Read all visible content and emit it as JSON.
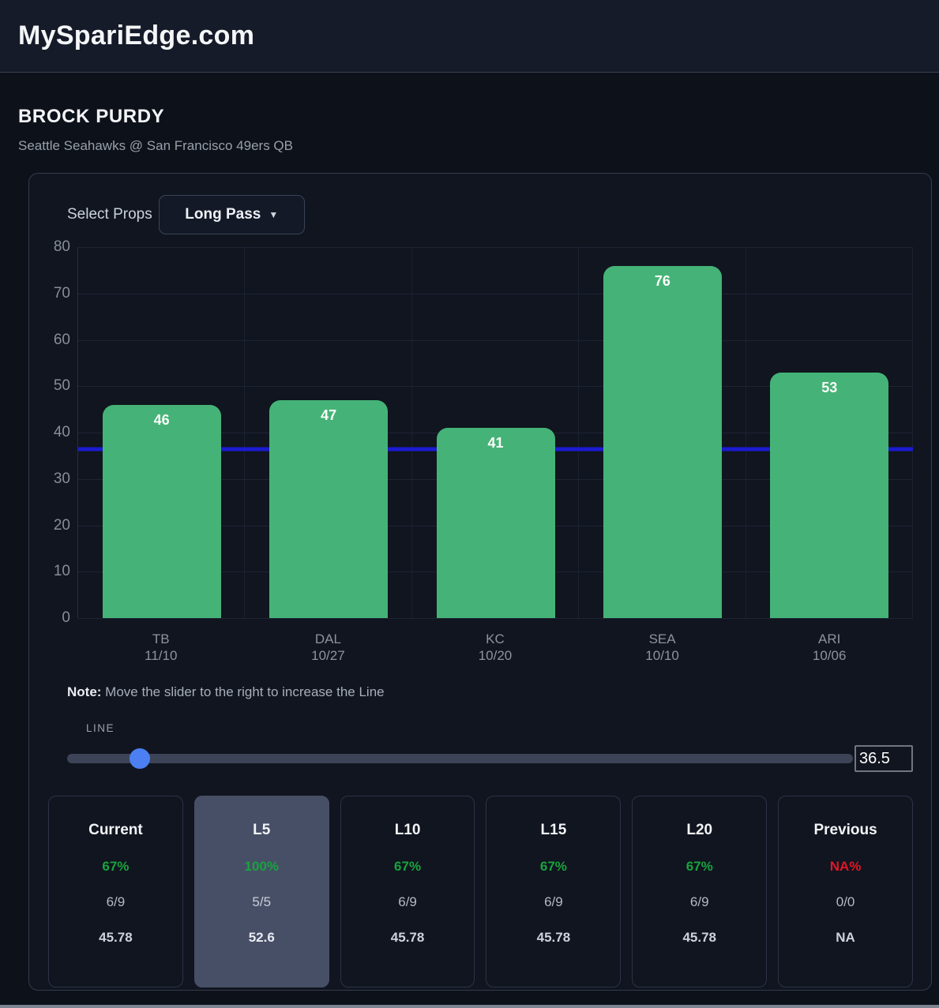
{
  "site": {
    "title": "MySpariEdge.com"
  },
  "player": {
    "name": "BROCK PURDY",
    "matchup": "Seattle Seahawks @ San Francisco 49ers QB"
  },
  "props": {
    "label": "Select Props",
    "selected": "Long Pass"
  },
  "chart_data": {
    "type": "bar",
    "title": "",
    "xlabel": "",
    "ylabel": "",
    "categories": [
      {
        "team": "TB",
        "date": "11/10"
      },
      {
        "team": "DAL",
        "date": "10/27"
      },
      {
        "team": "KC",
        "date": "10/20"
      },
      {
        "team": "SEA",
        "date": "10/10"
      },
      {
        "team": "ARI",
        "date": "10/06"
      }
    ],
    "values": [
      46,
      47,
      41,
      76,
      53
    ],
    "ylim": [
      0,
      80
    ],
    "yticks": [
      0,
      10,
      20,
      30,
      40,
      50,
      60,
      70,
      80
    ],
    "line_value": 36.5,
    "grid": true,
    "legend": false,
    "bar_color": "#45b377",
    "line_color": "#1b1bd1"
  },
  "note": {
    "bold": "Note:",
    "text": " Move the slider to the right to increase the Line"
  },
  "slider": {
    "label": "LINE",
    "value": "36.5",
    "thumb_percent": 9.2,
    "thumb_color": "#4c7ff2"
  },
  "cards": [
    {
      "label": "Current",
      "pct": "67%",
      "pct_color": "green",
      "ratio": "6/9",
      "value": "45.78",
      "highlight": false
    },
    {
      "label": "L5",
      "pct": "100%",
      "pct_color": "green",
      "ratio": "5/5",
      "value": "52.6",
      "highlight": true
    },
    {
      "label": "L10",
      "pct": "67%",
      "pct_color": "green",
      "ratio": "6/9",
      "value": "45.78",
      "highlight": false
    },
    {
      "label": "L15",
      "pct": "67%",
      "pct_color": "green",
      "ratio": "6/9",
      "value": "45.78",
      "highlight": false
    },
    {
      "label": "L20",
      "pct": "67%",
      "pct_color": "green",
      "ratio": "6/9",
      "value": "45.78",
      "highlight": false
    },
    {
      "label": "Previous",
      "pct": "NA%",
      "pct_color": "red",
      "ratio": "0/0",
      "value": "NA",
      "highlight": false
    }
  ],
  "colors": {
    "green": "#18a33d",
    "red": "#e31525",
    "accent_blue": "#4c7ff2"
  }
}
